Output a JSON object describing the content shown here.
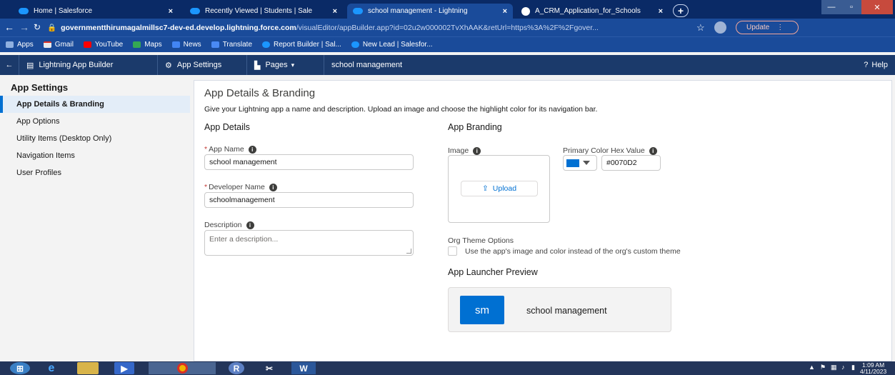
{
  "browser": {
    "tabs": [
      {
        "title": "Home | Salesforce"
      },
      {
        "title": "Recently Viewed | Students | Sale"
      },
      {
        "title": "school management - Lightning"
      },
      {
        "title": "A_CRM_Application_for_Schools"
      }
    ],
    "new_tab": "+",
    "url_host": "governmentthirumagalmillsc7-dev-ed.develop.lightning.force.com",
    "url_path": "/visualEditor/appBuilder.app?id=02u2w000002TvXhAAK&retUrl=https%3A%2F%2Fgover...",
    "update_label": "Update",
    "bookmarks": [
      "Apps",
      "Gmail",
      "YouTube",
      "Maps",
      "News",
      "Translate",
      "Report Builder | Sal...",
      "New Lead | Salesfor..."
    ]
  },
  "builder_header": {
    "title": "Lightning App Builder",
    "settings": "App Settings",
    "pages": "Pages",
    "app_name": "school management",
    "help": "Help"
  },
  "sidebar": {
    "title": "App Settings",
    "items": [
      {
        "label": "App Details & Branding"
      },
      {
        "label": "App Options"
      },
      {
        "label": "Utility Items (Desktop Only)"
      },
      {
        "label": "Navigation Items"
      },
      {
        "label": "User Profiles"
      }
    ]
  },
  "main": {
    "title": "App Details & Branding",
    "description": "Give your Lightning app a name and description. Upload an image and choose the highlight color for its navigation bar.",
    "details_heading": "App Details",
    "app_name_label": "App Name",
    "app_name_value": "school management",
    "dev_name_label": "Developer Name",
    "dev_name_value": "schoolmanagement",
    "description_label": "Description",
    "description_placeholder": "Enter a description...",
    "branding_heading": "App Branding",
    "image_label": "Image",
    "upload_label": "Upload",
    "color_label": "Primary Color Hex Value",
    "color_value": "#0070D2",
    "theme_heading": "Org Theme Options",
    "theme_checkbox_label": "Use the app's image and color instead of the org's custom theme",
    "launcher_heading": "App Launcher Preview",
    "launcher_initials": "sm",
    "launcher_name": "school management"
  },
  "taskbar": {
    "clock_time": "1:09 AM",
    "clock_date": "4/11/2023"
  },
  "colors": {
    "brand": "#0070D2",
    "header": "#1B3A6B",
    "browser": "#1A4B9A"
  }
}
